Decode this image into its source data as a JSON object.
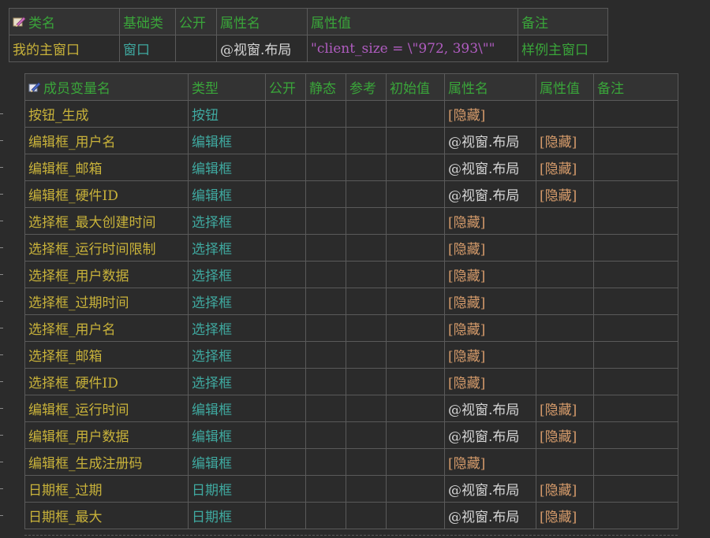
{
  "class_header": {
    "name_label": "类名",
    "base_label": "基础类",
    "public_label": "公开",
    "prop_name_label": "属性名",
    "prop_value_label": "属性值",
    "note_label": "备注"
  },
  "class_row": {
    "name": "我的主窗口",
    "base": "窗口",
    "public": "",
    "prop_name": "@视窗.布局",
    "prop_value": "\"client_size = \\\"972, 393\\\"\"",
    "note": "样例主窗口"
  },
  "member_header": {
    "name_label": "成员变量名",
    "type_label": "类型",
    "public_label": "公开",
    "static_label": "静态",
    "ref_label": "参考",
    "init_label": "初始值",
    "prop_name_label": "属性名",
    "prop_value_label": "属性值",
    "note_label": "备注"
  },
  "members": [
    {
      "name": "按钮_生成",
      "type": "按钮",
      "prop_name": "[隐藏]",
      "prop_value": ""
    },
    {
      "name": "编辑框_用户名",
      "type": "编辑框",
      "prop_name": "@视窗.布局",
      "prop_value": "[隐藏]"
    },
    {
      "name": "编辑框_邮箱",
      "type": "编辑框",
      "prop_name": "@视窗.布局",
      "prop_value": "[隐藏]"
    },
    {
      "name": "编辑框_硬件ID",
      "type": "编辑框",
      "prop_name": "@视窗.布局",
      "prop_value": "[隐藏]"
    },
    {
      "name": "选择框_最大创建时间",
      "type": "选择框",
      "prop_name": "[隐藏]",
      "prop_value": ""
    },
    {
      "name": "选择框_运行时间限制",
      "type": "选择框",
      "prop_name": "[隐藏]",
      "prop_value": ""
    },
    {
      "name": "选择框_用户数据",
      "type": "选择框",
      "prop_name": "[隐藏]",
      "prop_value": ""
    },
    {
      "name": "选择框_过期时间",
      "type": "选择框",
      "prop_name": "[隐藏]",
      "prop_value": ""
    },
    {
      "name": "选择框_用户名",
      "type": "选择框",
      "prop_name": "[隐藏]",
      "prop_value": ""
    },
    {
      "name": "选择框_邮箱",
      "type": "选择框",
      "prop_name": "[隐藏]",
      "prop_value": ""
    },
    {
      "name": "选择框_硬件ID",
      "type": "选择框",
      "prop_name": "[隐藏]",
      "prop_value": ""
    },
    {
      "name": "编辑框_运行时间",
      "type": "编辑框",
      "prop_name": "@视窗.布局",
      "prop_value": "[隐藏]"
    },
    {
      "name": "编辑框_用户数据",
      "type": "编辑框",
      "prop_name": "@视窗.布局",
      "prop_value": "[隐藏]"
    },
    {
      "name": "编辑框_生成注册码",
      "type": "编辑框",
      "prop_name": "[隐藏]",
      "prop_value": ""
    },
    {
      "name": "日期框_过期",
      "type": "日期框",
      "prop_name": "@视窗.布局",
      "prop_value": "[隐藏]"
    },
    {
      "name": "日期框_最大",
      "type": "日期框",
      "prop_name": "@视窗.布局",
      "prop_value": "[隐藏]"
    }
  ]
}
